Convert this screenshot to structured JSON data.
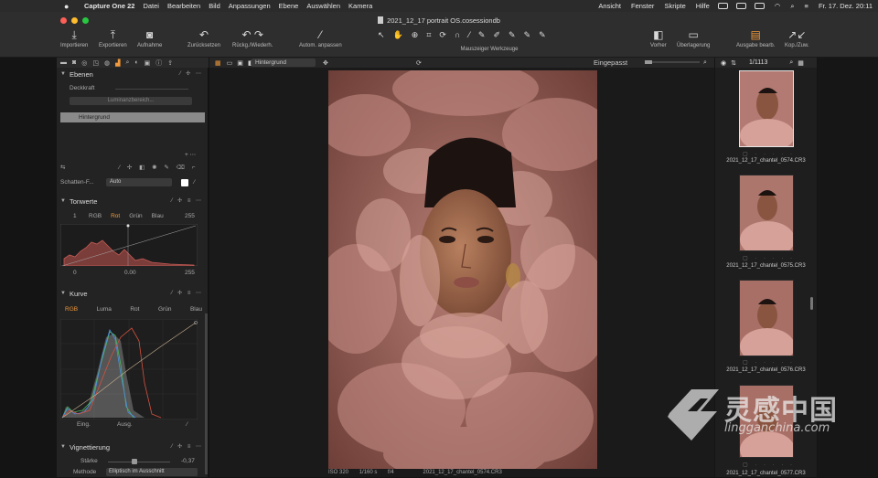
{
  "menubar": {
    "app": "Capture One 22",
    "items": [
      "Datei",
      "Bearbeiten",
      "Bild",
      "Anpassungen",
      "Ebene",
      "Auswählen",
      "Kamera"
    ],
    "right_items": [
      "Ansicht",
      "Fenster",
      "Skripte",
      "Hilfe"
    ],
    "clock": "Fr. 17. Dez.  20:11"
  },
  "window": {
    "title": "2021_12_17 portrait OS.cosessiondb"
  },
  "toolbar": {
    "importieren": "Importieren",
    "exportieren": "Exportieren",
    "aufnahme": "Aufnahme",
    "zurueck": "Zurücksetzen",
    "rueckg": "Rückg./Wiederh.",
    "autom": "Autom. anpassen",
    "werkzeuge": "Mauszeiger Werkzeuge",
    "vorher": "Vorher",
    "ueberlagerung": "Überlagerung",
    "ausgabe": "Ausgabe bearb.",
    "kopzuw": "Kop./Zuw."
  },
  "left_panel": {
    "ebenen": {
      "title": "Ebenen",
      "deckkraft": "Deckkraft",
      "luminanz": "Luminanzbereich...",
      "layer": "Hintergrund"
    },
    "schatten": {
      "label": "Schatten-F...",
      "value": "Auto"
    },
    "tonwerte": {
      "title": "Tonwerte",
      "channels": [
        "RGB",
        "Rot",
        "Grün",
        "Blau"
      ],
      "left_val": "1",
      "right_val": "255",
      "in_low": "0",
      "in_mid": "0.00",
      "in_high": "255"
    },
    "kurve": {
      "title": "Kurve",
      "channels": [
        "RGB",
        "Luma",
        "Rot",
        "Grün",
        "Blau"
      ],
      "eing": "Eing.",
      "ausg": "Ausg."
    },
    "vignettierung": {
      "title": "Vignettierung",
      "staerke_label": "Stärke",
      "staerke_val": "-0,37",
      "methode_label": "Methode",
      "methode_val": "Elliptisch im Ausschnitt"
    }
  },
  "viewer": {
    "layer_dropdown": "Hintergrund",
    "zoom": "Eingepasst",
    "meta": [
      "ISO 320",
      "1/160 s",
      "f/4",
      "2021_12_17_chantel_0574.CR3"
    ]
  },
  "browser": {
    "count": "1/1113",
    "thumbs": [
      "2021_12_17_chantel_0574.CR3",
      "2021_12_17_chantel_0575.CR3",
      "2021_12_17_chantel_0576.CR3",
      "2021_12_17_chantel_0577.CR3"
    ]
  },
  "watermark": {
    "cn": "灵感中国",
    "en": "lingganchina.com"
  },
  "colors": {
    "accent": "#f29a3c",
    "panel": "#232323",
    "bg": "#191a19"
  }
}
